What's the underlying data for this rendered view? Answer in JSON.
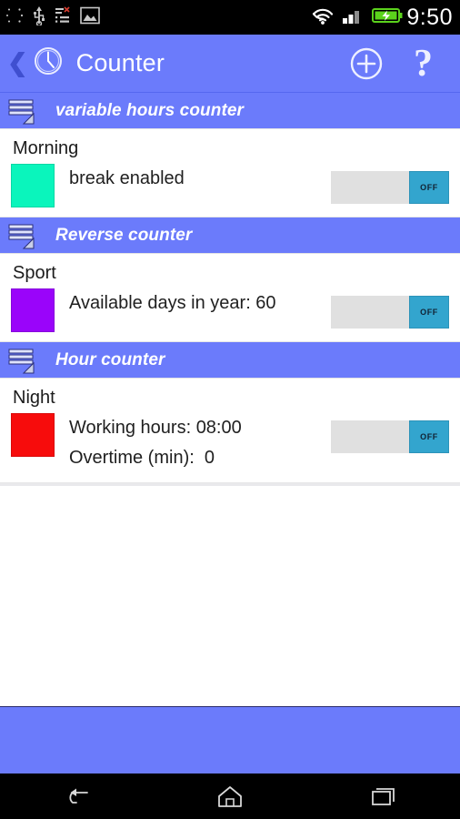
{
  "status_bar": {
    "icons": [
      "brightness-icon",
      "usb-icon",
      "task-list-error-icon",
      "image-icon"
    ],
    "right_icons": [
      "wifi-icon",
      "signal-icon",
      "battery-charging-icon"
    ],
    "clock": "9:50"
  },
  "app_bar": {
    "back_icon": "back-chevron-icon",
    "app_icon": "clock-icon",
    "title": "Counter",
    "add_icon": "plus-circle-icon",
    "help_label": "?"
  },
  "sections": [
    {
      "header_icon": "list-icon",
      "header_title": "variable hours counter",
      "item": {
        "name": "Morning",
        "color": "#0AF5BC",
        "lines": [
          "break enabled"
        ],
        "toggle_label": "OFF",
        "toggle_state": "off"
      }
    },
    {
      "header_icon": "list-icon",
      "header_title": "Reverse counter",
      "item": {
        "name": "Sport",
        "color": "#9A04FA",
        "lines": [
          "Available days in year: 60"
        ],
        "toggle_label": "OFF",
        "toggle_state": "off"
      }
    },
    {
      "header_icon": "list-icon",
      "header_title": "Hour counter",
      "item": {
        "name": "Night",
        "color": "#F70C0C",
        "lines": [
          "Working hours: 08:00",
          "Overtime (min):  0"
        ],
        "toggle_label": "OFF",
        "toggle_state": "off"
      }
    }
  ],
  "nav_bar": {
    "back_icon": "nav-back-icon",
    "home_icon": "nav-home-icon",
    "recents_icon": "nav-recents-icon"
  },
  "theme": {
    "accent": "#6B7BFB",
    "toggle_thumb": "#33A5CE",
    "toggle_track": "#E0E0E0"
  }
}
